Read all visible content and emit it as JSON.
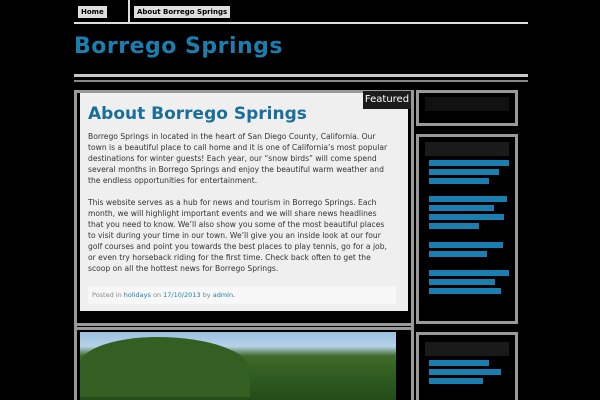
{
  "nav": {
    "items": [
      {
        "label": "Home"
      },
      {
        "label": "About Borrego Springs"
      }
    ]
  },
  "site": {
    "title": "Borrego Springs"
  },
  "post": {
    "badge": "Featured",
    "title": "About Borrego Springs",
    "paragraphs": [
      "Borrego Springs in located in the heart of San Diego County, California. Our town is a beautiful place to call home and it is one of California’s most popular destinations for winter guests! Each year, our “snow birds” will come spend several months in Borrego Springs and enjoy the beautiful warm weather and the endless opportunities for entertainment.",
      "This website serves as a hub for news and tourism in Borrego Springs. Each month, we will highlight important events and we will share news headlines that you need to know. We’ll also show you some of the most beautiful places to visit during your time in our town. We’ll give you an inside look at our four golf courses and point you towards the best places to play tennis, go for a job, or even try horseback riding for the first time. Check back often to get the scoop on all the hottest news for Borrego Springs."
    ],
    "meta": {
      "posted_in": "Posted in",
      "category": "holidays",
      "on": "on",
      "date": "17/10/2013",
      "by": "by",
      "author": "admin."
    }
  },
  "sidebar": {
    "links": [
      "",
      "",
      "",
      "",
      ""
    ]
  },
  "colors": {
    "accent": "#1a7fb0",
    "background": "#000000",
    "post_background": "#efefef"
  }
}
